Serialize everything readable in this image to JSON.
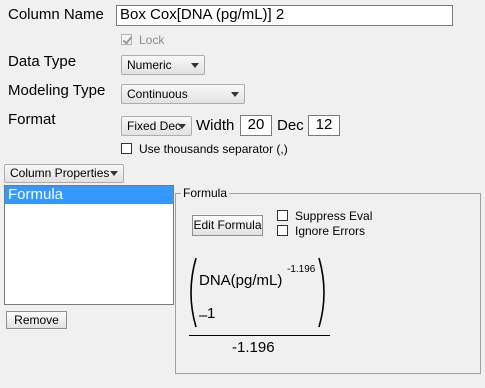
{
  "column_name": {
    "label": "Column Name",
    "value": "Box Cox[DNA (pg/mL)] 2"
  },
  "lock": {
    "label": "Lock",
    "checked": true
  },
  "data_type": {
    "label": "Data Type",
    "value": "Numeric"
  },
  "modeling_type": {
    "label": "Modeling Type",
    "value": "Continuous"
  },
  "format": {
    "label": "Format",
    "value": "Fixed Dec",
    "width_label": "Width",
    "width_value": "20",
    "dec_label": "Dec",
    "dec_value": "12",
    "thousands_label": "Use thousands separator (,)"
  },
  "column_properties": {
    "button_label": "Column Properties",
    "items": [
      "Formula"
    ],
    "selected_index": 0,
    "remove_label": "Remove"
  },
  "formula_panel": {
    "title": "Formula",
    "edit_button_label": "Edit Formula",
    "suppress_eval_label": "Suppress Eval",
    "ignore_errors_label": "Ignore Errors",
    "expression": {
      "base": "DNA(pg/mL)",
      "exponent": "-1.196",
      "minus_sign": "–",
      "subtract": "1",
      "denominator": "-1.196"
    }
  }
}
